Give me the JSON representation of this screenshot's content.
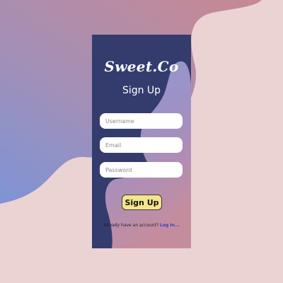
{
  "brand": {
    "name": "Sweet.Co"
  },
  "form": {
    "title": "Sign Up",
    "username_placeholder": "Username",
    "email_placeholder": "Email",
    "password_placeholder": "Password",
    "submit_label": "Sign Up"
  },
  "footer": {
    "prompt": "Already have an account?",
    "login_label": "Log In..."
  },
  "colors": {
    "page_background": "#ecd3d3",
    "card_background": "#343c6e",
    "button_background": "#f3e58c",
    "link": "#2f3fd0"
  }
}
